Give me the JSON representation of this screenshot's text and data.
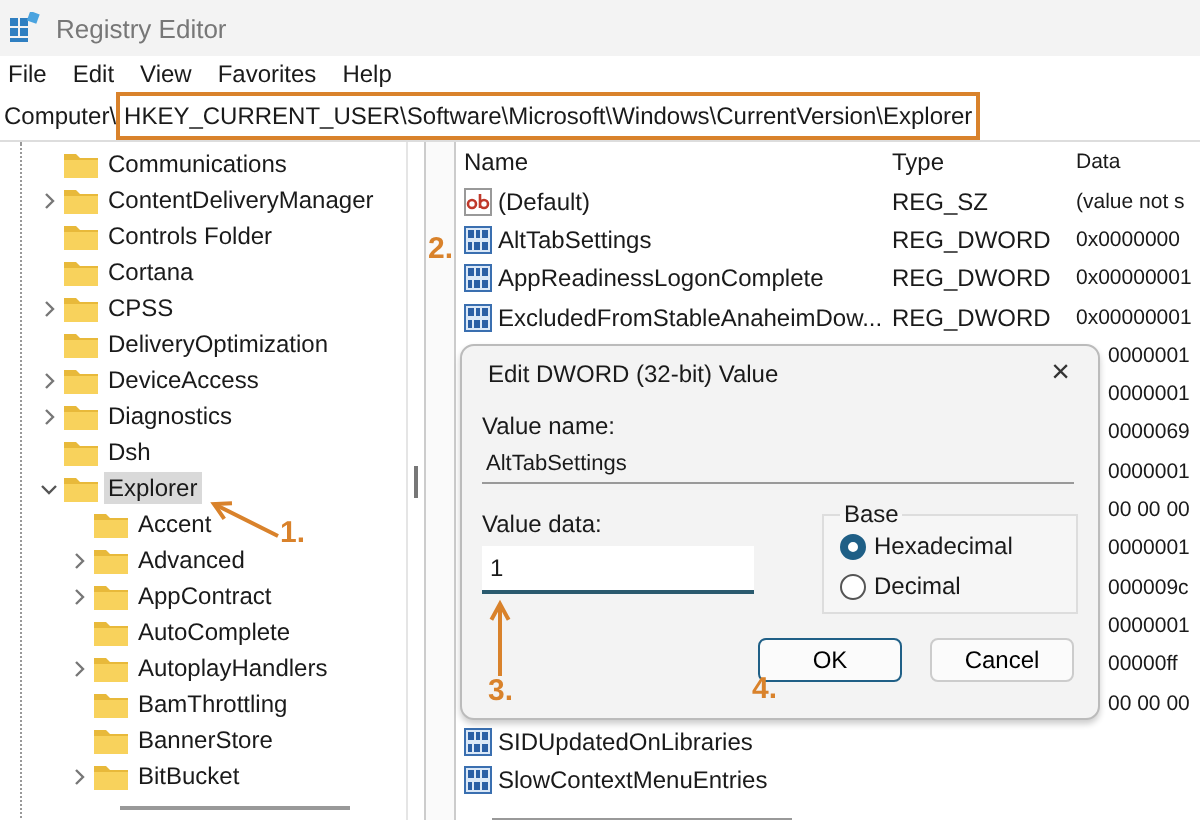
{
  "window": {
    "title": "Registry Editor"
  },
  "menu": [
    "File",
    "Edit",
    "View",
    "Favorites",
    "Help"
  ],
  "address": {
    "prefix": "Computer\\",
    "path": "HKEY_CURRENT_USER\\Software\\Microsoft\\Windows\\CurrentVersion\\Explorer",
    "highlighted": true
  },
  "tree": [
    {
      "label": "Communications",
      "selected": false
    },
    {
      "label": "ContentDeliveryManager",
      "expanded": false,
      "selected": false
    },
    {
      "label": "Controls Folder",
      "selected": false
    },
    {
      "label": "Cortana",
      "selected": false
    },
    {
      "label": "CPSS",
      "expanded": false,
      "selected": false
    },
    {
      "label": "DeliveryOptimization",
      "selected": false
    },
    {
      "label": "DeviceAccess",
      "expanded": false,
      "selected": false
    },
    {
      "label": "Diagnostics",
      "expanded": false,
      "selected": false
    },
    {
      "label": "Dsh",
      "selected": false
    },
    {
      "label": "Explorer",
      "expanded": true,
      "selected": true,
      "children": [
        {
          "label": "Accent",
          "selected": false
        },
        {
          "label": "Advanced",
          "expanded": false,
          "selected": false
        },
        {
          "label": "AppContract",
          "expanded": false,
          "selected": false
        },
        {
          "label": "AutoComplete",
          "selected": false
        },
        {
          "label": "AutoplayHandlers",
          "expanded": false,
          "selected": false
        },
        {
          "label": "BamThrottling",
          "selected": false
        },
        {
          "label": "BannerStore",
          "selected": false
        },
        {
          "label": "BitBucket",
          "expanded": false,
          "selected": false
        }
      ]
    }
  ],
  "values": {
    "columns": [
      "Name",
      "Type",
      "Data"
    ],
    "rows": [
      {
        "kind": "string",
        "name": "(Default)",
        "type": "REG_SZ",
        "data": "(value not s"
      },
      {
        "kind": "dword",
        "name": "AltTabSettings",
        "type": "REG_DWORD",
        "data": "0x0000000"
      },
      {
        "kind": "dword",
        "name": "AppReadinessLogonComplete",
        "type": "REG_DWORD",
        "data": "0x00000001"
      },
      {
        "kind": "dword",
        "name": "ExcludedFromStableAnaheimDow...",
        "type": "REG_DWORD",
        "data": "0x00000001"
      },
      {
        "kind": "covered",
        "data": "0000001"
      },
      {
        "kind": "covered",
        "data": "0000001"
      },
      {
        "kind": "covered",
        "data": "0000069"
      },
      {
        "kind": "covered",
        "data": "0000001"
      },
      {
        "kind": "covered",
        "data": "00 00 00"
      },
      {
        "kind": "covered",
        "data": "0000001"
      },
      {
        "kind": "covered",
        "data": "000009c"
      },
      {
        "kind": "covered",
        "data": "0000001"
      },
      {
        "kind": "covered",
        "data": "00000ff"
      },
      {
        "kind": "covered",
        "data": "00 00 00"
      },
      {
        "kind": "dword",
        "name": "SIDUpdatedOnLibraries"
      },
      {
        "kind": "dword",
        "name": "SlowContextMenuEntries"
      }
    ]
  },
  "dialog": {
    "title": "Edit DWORD (32-bit) Value",
    "close": "×",
    "value_name_label": "Value name:",
    "value_name": "AltTabSettings",
    "value_data_label": "Value data:",
    "value_data": "1",
    "base_label": "Base",
    "base_options": [
      {
        "label": "Hexadecimal",
        "selected": true
      },
      {
        "label": "Decimal",
        "selected": false
      }
    ],
    "buttons": [
      {
        "label": "OK",
        "default": true
      },
      {
        "label": "Cancel",
        "default": false
      }
    ]
  },
  "annotations": [
    {
      "label": "1."
    },
    {
      "label": "2."
    },
    {
      "label": "3."
    },
    {
      "label": "4."
    }
  ]
}
